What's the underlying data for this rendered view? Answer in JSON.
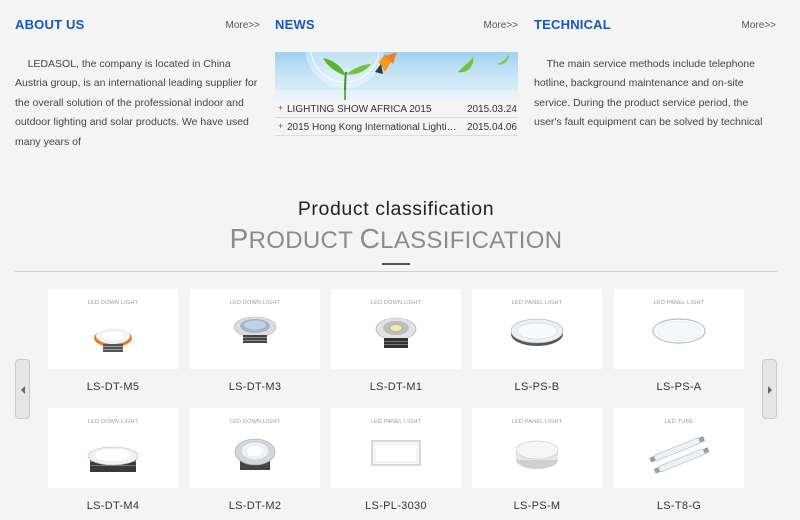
{
  "about": {
    "title": "ABOUT US",
    "more": "More>>",
    "text": "LEDASOL, the company is located in China Austria group, is an international leading supplier for the overall solution of the professional indoor and outdoor lighting and solar products. We have used many years of"
  },
  "news": {
    "title": "NEWS",
    "more": "More>>",
    "items": [
      {
        "bullet": "+",
        "title": "LIGHTING SHOW AFRICA 2015",
        "date": "2015.03.24"
      },
      {
        "bullet": "+",
        "title": "2015 Hong Kong International Lighting Fair",
        "date": "2015.04.06"
      }
    ]
  },
  "technical": {
    "title": "TECHNICAL",
    "more": "More>>",
    "text": "The main service methods include telephone hotline, background maintenance and on-site service. During the product service period, the user's fault equipment can be solved by technical"
  },
  "products": {
    "title": "Product classification",
    "subtitle_first": "P",
    "subtitle_rest": "roduct ",
    "subtitle_first2": "C",
    "subtitle_rest2": "lassification",
    "items": [
      {
        "name": "LS-DT-M5",
        "category": "LED DOWN LIGHT",
        "icon": "downlight-orange-icon",
        "accent": "#f07a1a"
      },
      {
        "name": "LS-DT-M3",
        "category": "LED DOWN LIGHT",
        "icon": "downlight-silver-icon",
        "accent": "#9aa7b8"
      },
      {
        "name": "LS-DT-M1",
        "category": "LED DOWN LIGHT",
        "icon": "downlight-cob-icon",
        "accent": "#c9c9c9"
      },
      {
        "name": "LS-PS-B",
        "category": "LED PANEL LIGHT",
        "icon": "panel-round-thick-icon",
        "accent": "#d8dde2"
      },
      {
        "name": "LS-PS-A",
        "category": "LED PANEL LIGHT",
        "icon": "panel-round-thin-icon",
        "accent": "#e0e6ec"
      },
      {
        "name": "LS-DT-M4",
        "category": "LED DOWN LIGHT",
        "icon": "downlight-wide-icon",
        "accent": "#dddddd"
      },
      {
        "name": "LS-DT-M2",
        "category": "LED DOWN LIGHT",
        "icon": "downlight-chrome-icon",
        "accent": "#b6bcc4"
      },
      {
        "name": "LS-PL-3030",
        "category": "LED PANEL LIGHT",
        "icon": "panel-square-icon",
        "accent": "#e8ecee"
      },
      {
        "name": "LS-PS-M",
        "category": "LED PANEL LIGHT",
        "icon": "panel-surface-icon",
        "accent": "#e4e4e4"
      },
      {
        "name": "LS-T8-G",
        "category": "LED TUBE",
        "icon": "tube-icon",
        "accent": "#d4d8dc"
      }
    ]
  },
  "carousel": {
    "prev_icon": "chevron-left-icon",
    "next_icon": "chevron-right-icon"
  },
  "colors": {
    "heading": "#1b57b3",
    "background": "#f4f4f4"
  }
}
